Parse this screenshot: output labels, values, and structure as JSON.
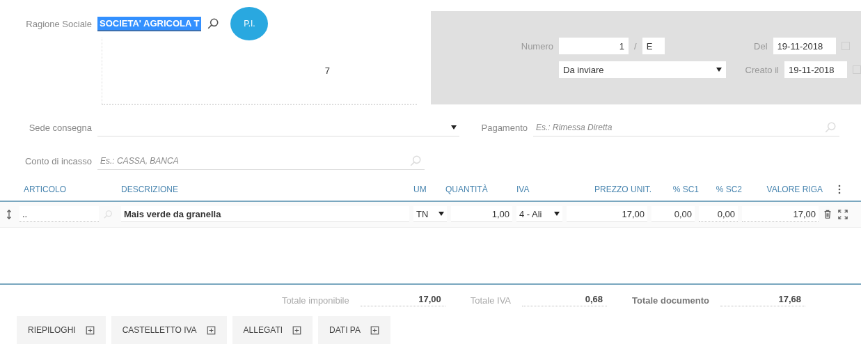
{
  "customer": {
    "label": "Ragione Sociale",
    "value": "SOCIETA' AGRICOLA T",
    "pi_button": "P.I.",
    "address_number": "7"
  },
  "document": {
    "number_label": "Numero",
    "number": "1",
    "separator": "/",
    "series": "E",
    "status": "Da inviare",
    "date_label": "Del",
    "date": "19-11-2018",
    "created_label": "Creato il",
    "created": "19-11-2018"
  },
  "delivery": {
    "label": "Sede consegna"
  },
  "payment": {
    "label": "Pagamento",
    "placeholder": "Es.: Rimessa Diretta"
  },
  "collection_account": {
    "label": "Conto di incasso",
    "placeholder": "Es.: CASSA, BANCA"
  },
  "table": {
    "columns": [
      "ARTICOLO",
      "DESCRIZIONE",
      "UM",
      "QUANTITÀ",
      "IVA",
      "PREZZO UNIT.",
      "% SC1",
      "% SC2",
      "VALORE RIGA"
    ],
    "rows": [
      {
        "articolo": "..",
        "descrizione": "Mais verde da granella",
        "um": "TN",
        "quantita": "1,00",
        "iva": "4 - Ali",
        "prezzo": "17,00",
        "sc1": "0,00",
        "sc2": "0,00",
        "valore": "17,00"
      }
    ]
  },
  "totals": [
    {
      "label": "Totale imponibile",
      "value": "17,00",
      "strong": false
    },
    {
      "label": "Totale IVA",
      "value": "0,68",
      "strong": false
    },
    {
      "label": "Totale documento",
      "value": "17,68",
      "strong": true
    }
  ],
  "sections": [
    "RIEPILOGHI",
    "CASTELLETTO IVA",
    "ALLEGATI",
    "DATI PA"
  ]
}
